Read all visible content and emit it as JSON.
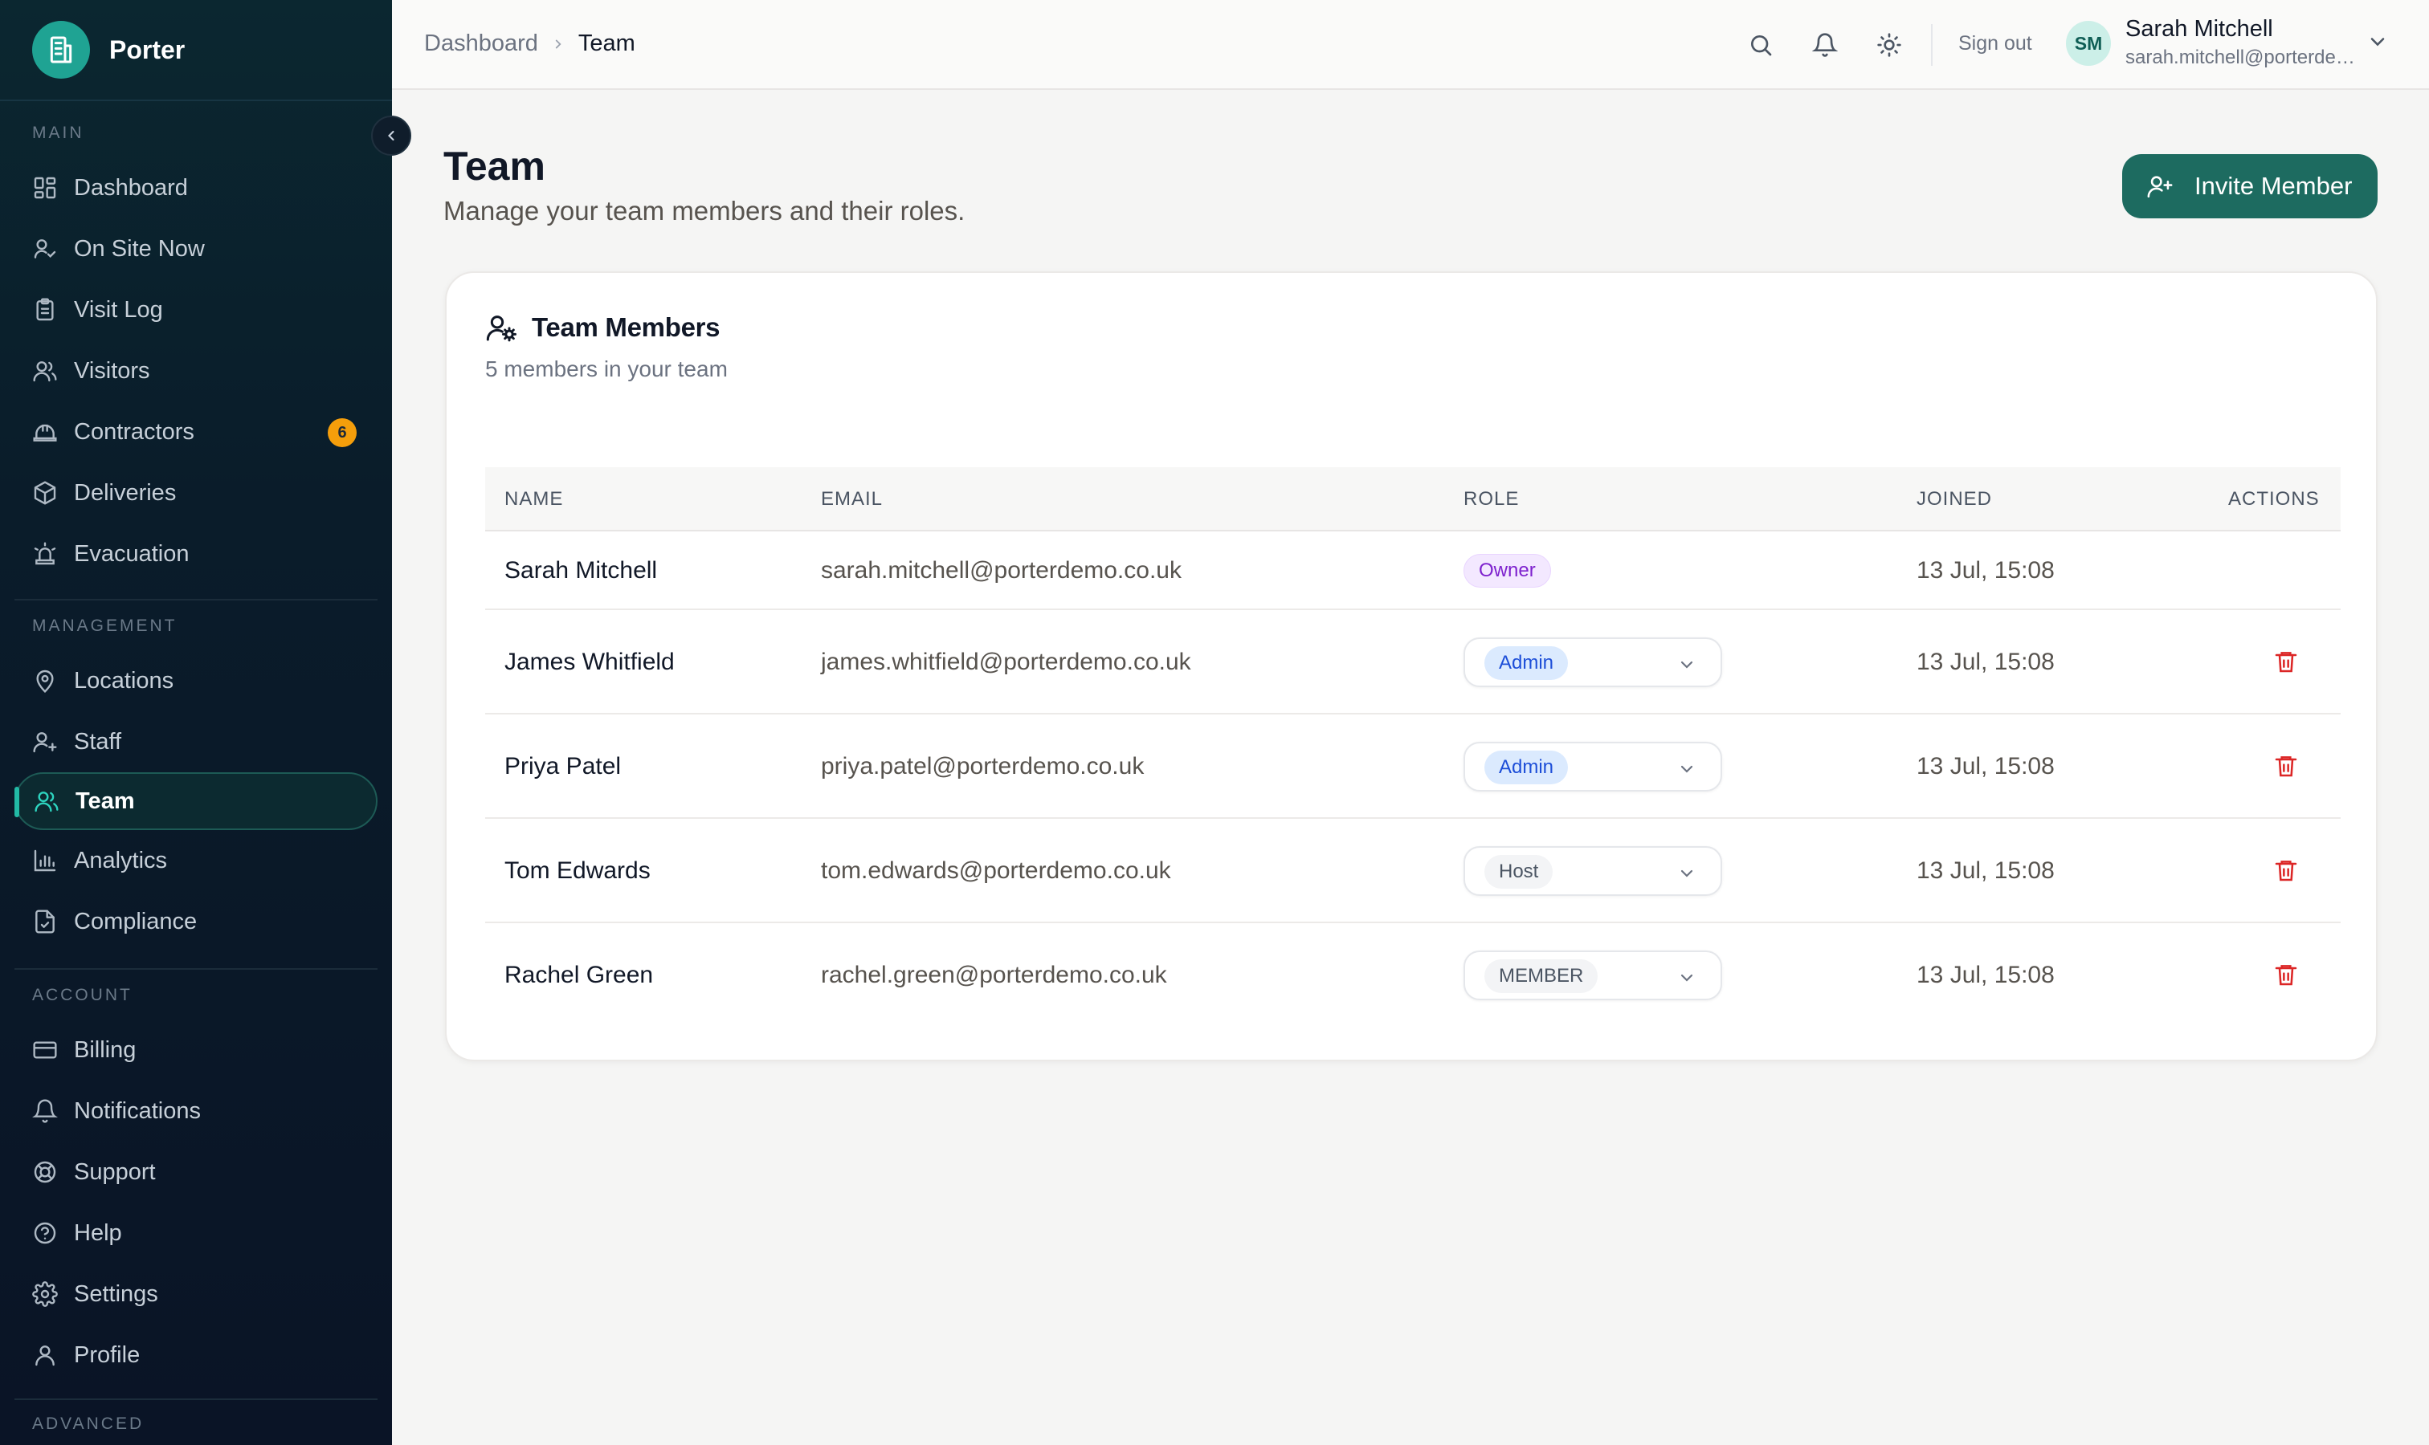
{
  "app": {
    "name": "Porter"
  },
  "sidebar": {
    "sections": [
      {
        "label": "MAIN",
        "items": [
          {
            "label": "Dashboard",
            "icon": "dashboard-icon"
          },
          {
            "label": "On Site Now",
            "icon": "user-check-icon"
          },
          {
            "label": "Visit Log",
            "icon": "clipboard-icon"
          },
          {
            "label": "Visitors",
            "icon": "users-icon"
          },
          {
            "label": "Contractors",
            "icon": "hard-hat-icon",
            "badge": "6"
          },
          {
            "label": "Deliveries",
            "icon": "package-icon"
          },
          {
            "label": "Evacuation",
            "icon": "siren-icon"
          }
        ]
      },
      {
        "label": "MANAGEMENT",
        "items": [
          {
            "label": "Locations",
            "icon": "map-pin-icon"
          },
          {
            "label": "Staff",
            "icon": "user-plus-icon"
          },
          {
            "label": "Team",
            "icon": "users-icon",
            "active": true
          },
          {
            "label": "Analytics",
            "icon": "bar-chart-icon"
          },
          {
            "label": "Compliance",
            "icon": "file-check-icon"
          }
        ]
      },
      {
        "label": "ACCOUNT",
        "items": [
          {
            "label": "Billing",
            "icon": "credit-card-icon"
          },
          {
            "label": "Notifications",
            "icon": "bell-icon"
          },
          {
            "label": "Support",
            "icon": "lifebuoy-icon"
          },
          {
            "label": "Help",
            "icon": "help-circle-icon"
          },
          {
            "label": "Settings",
            "icon": "gear-icon"
          },
          {
            "label": "Profile",
            "icon": "user-icon"
          }
        ]
      },
      {
        "label": "ADVANCED",
        "items": []
      }
    ]
  },
  "header": {
    "breadcrumb": {
      "parent": "Dashboard",
      "current": "Team"
    },
    "sign_out": "Sign out",
    "user": {
      "initials": "SM",
      "name": "Sarah Mitchell",
      "email": "sarah.mitchell@porterdemo.co.uk"
    }
  },
  "page": {
    "title": "Team",
    "subtitle": "Manage your team members and their roles.",
    "invite_button": "Invite Member"
  },
  "card": {
    "title": "Team Members",
    "subtitle": "5 members in your team",
    "columns": [
      "NAME",
      "EMAIL",
      "ROLE",
      "JOINED",
      "ACTIONS"
    ],
    "rows": [
      {
        "name": "Sarah Mitchell",
        "email": "sarah.mitchell@porterdemo.co.uk",
        "role": "Owner",
        "joined": "13 Jul, 15:08"
      },
      {
        "name": "James Whitfield",
        "email": "james.whitfield@porterdemo.co.uk",
        "role": "Admin",
        "joined": "13 Jul, 15:08"
      },
      {
        "name": "Priya Patel",
        "email": "priya.patel@porterdemo.co.uk",
        "role": "Admin",
        "joined": "13 Jul, 15:08"
      },
      {
        "name": "Tom Edwards",
        "email": "tom.edwards@porterdemo.co.uk",
        "role": "Host",
        "joined": "13 Jul, 15:08"
      },
      {
        "name": "Rachel Green",
        "email": "rachel.green@porterdemo.co.uk",
        "role": "MEMBER",
        "joined": "13 Jul, 15:08"
      }
    ]
  },
  "colors": {
    "accent": "#1d6b60",
    "sidebar_bg": "#0a1c2a",
    "badge": "#f59e0b",
    "danger": "#dc2626",
    "owner_pill_bg": "#f3e8ff",
    "owner_pill_text": "#7e22ce",
    "admin_pill_bg": "#dbeafe",
    "admin_pill_text": "#1d4ed8",
    "neutral_pill_bg": "#f3f4f6",
    "neutral_pill_text": "#4b5563"
  }
}
